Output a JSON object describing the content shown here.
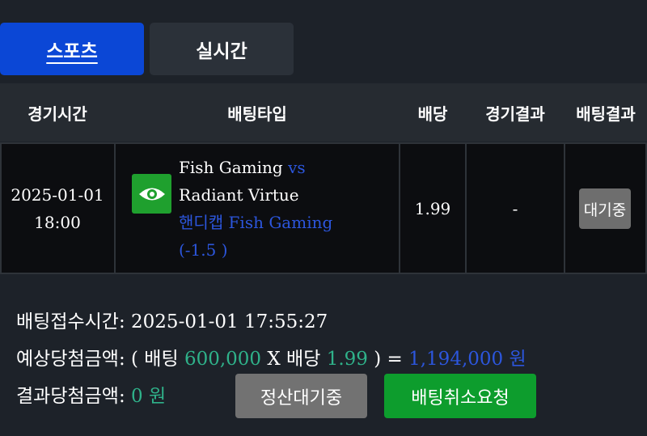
{
  "tabs": [
    {
      "label": "스포츠",
      "active": true
    },
    {
      "label": "실시간",
      "active": false
    }
  ],
  "table": {
    "headers": [
      "경기시간",
      "배팅타입",
      "배당",
      "경기결과",
      "배팅결과"
    ],
    "row": {
      "date": "2025-01-01",
      "time": "18:00",
      "home": "Fish Gaming",
      "vs": "vs",
      "away": "Radiant Virtue",
      "bet_type": "핸디캡 Fish Gaming",
      "handicap": "(-1.5 )",
      "odds": "1.99",
      "game_result": "-",
      "bet_result": "대기중"
    }
  },
  "info": {
    "receipt_label": "배팅접수시간: ",
    "receipt_time": "2025-01-01 17:55:27",
    "expected_label": "예상당첨금액: ( 배팅 ",
    "stake": "600,000",
    "x_odds_label": " X 배당 ",
    "odds": "1.99",
    "equals": " ) = ",
    "payout": "1,194,000 원",
    "result_label": "결과당첨금액: ",
    "result_amount": "0 원"
  },
  "buttons": {
    "settle_wait": "정산대기중",
    "cancel_request": "배팅취소요청"
  },
  "colors": {
    "accent_blue": "#0b47d6",
    "link_blue": "#2c56dd",
    "green_text": "#2fb28a",
    "green_button": "#0d9d2d",
    "icon": "eye-icon"
  }
}
